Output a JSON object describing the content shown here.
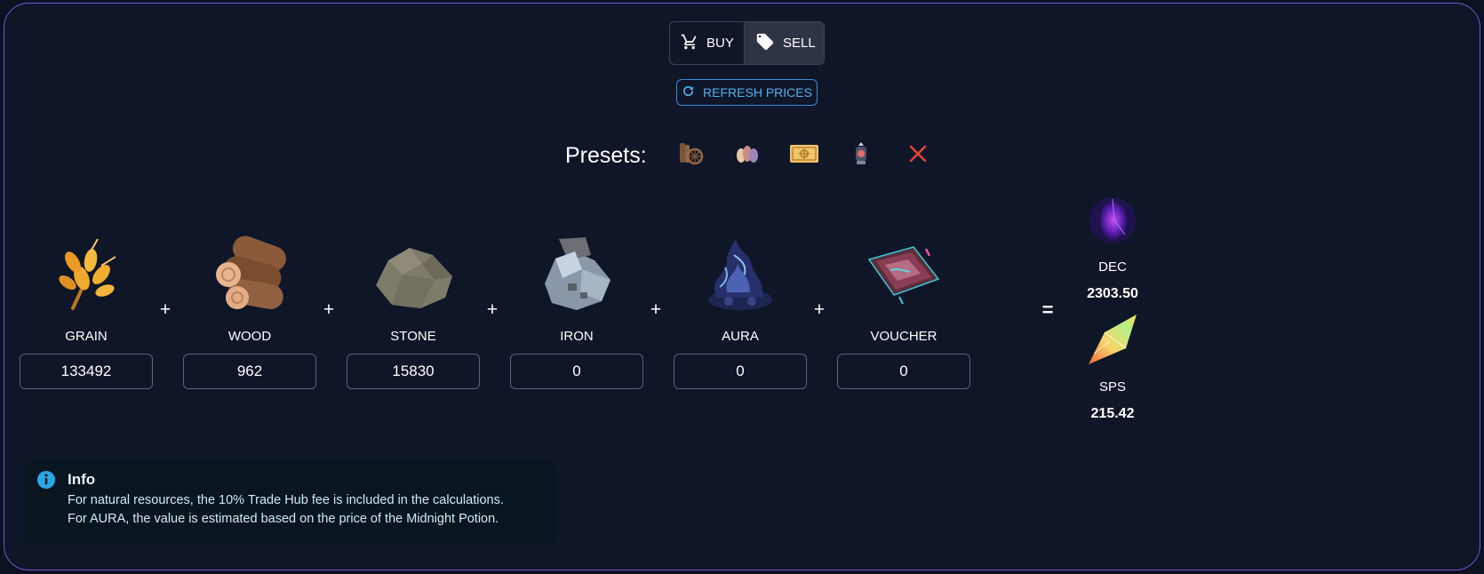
{
  "mode_toggle": {
    "buy_label": "BUY",
    "sell_label": "SELL",
    "selected": "SELL"
  },
  "refresh_label": "REFRESH PRICES",
  "presets": {
    "label": "Presets:",
    "items": [
      {
        "icon": "wood-bundle-icon"
      },
      {
        "icon": "potions-icon"
      },
      {
        "icon": "voucher-ticket-icon"
      },
      {
        "icon": "lantern-icon"
      },
      {
        "icon": "close-icon"
      }
    ]
  },
  "resources": [
    {
      "name": "GRAIN",
      "value": "133492",
      "icon": "grain-icon"
    },
    {
      "name": "WOOD",
      "value": "962",
      "icon": "wood-icon"
    },
    {
      "name": "STONE",
      "value": "15830",
      "icon": "stone-icon"
    },
    {
      "name": "IRON",
      "value": "0",
      "icon": "iron-icon"
    },
    {
      "name": "AURA",
      "value": "0",
      "icon": "aura-icon"
    },
    {
      "name": "VOUCHER",
      "value": "0",
      "icon": "voucher-icon"
    }
  ],
  "operators": {
    "plus": "+",
    "equals": "="
  },
  "results": [
    {
      "name": "DEC",
      "value": "2303.50",
      "icon": "dec-crystal-icon"
    },
    {
      "name": "SPS",
      "value": "215.42",
      "icon": "sps-shard-icon"
    }
  ],
  "info": {
    "title": "Info",
    "lines": [
      "For natural resources, the 10% Trade Hub fee is included in the calculations.",
      "For AURA, the value is estimated based on the price of the Midnight Potion."
    ]
  },
  "colors": {
    "accent_border": "#6d5bd0",
    "refresh": "#4fb3f2",
    "close": "#e0443a",
    "info_icon": "#29a8e8"
  }
}
